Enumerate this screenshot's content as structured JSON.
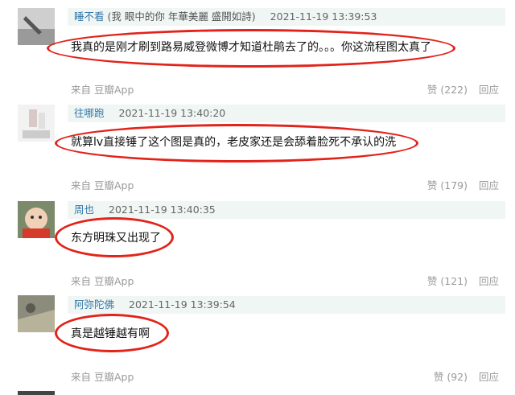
{
  "comments": [
    {
      "user": "睡不看",
      "user_extra": "(我 眼中的你 年華美麗 盛開如詩)",
      "time": "2021-11-19 13:39:53",
      "text": "我真的是刚才刷到路易威登微博才知道杜鹃去了的。。。你这流程图太真了",
      "from": "来自 豆瓣App",
      "vote": "赞 (222)",
      "reply": "回应"
    },
    {
      "user": "往哪跑",
      "user_extra": "",
      "time": "2021-11-19 13:40:20",
      "text": "就算lv直接锤了这个图是真的，老皮家还是会舔着脸死不承认的洗",
      "from": "来自 豆瓣App",
      "vote": "赞 (179)",
      "reply": "回应"
    },
    {
      "user": "周也",
      "user_extra": "",
      "time": "2021-11-19 13:40:35",
      "text": "东方明珠又出现了",
      "from": "来自 豆瓣App",
      "vote": "赞 (121)",
      "reply": "回应"
    },
    {
      "user": "阿弥陀佛",
      "user_extra": "",
      "time": "2021-11-19 13:39:54",
      "text": "真是越锤越有啊",
      "from": "来自 豆瓣App",
      "vote": "赞 (92)",
      "reply": "回应"
    }
  ],
  "colors": {
    "username": "#3377aa",
    "header_bg": "#f0f6f3",
    "highlight": "#e2231a",
    "meta": "#9a9a9a"
  }
}
